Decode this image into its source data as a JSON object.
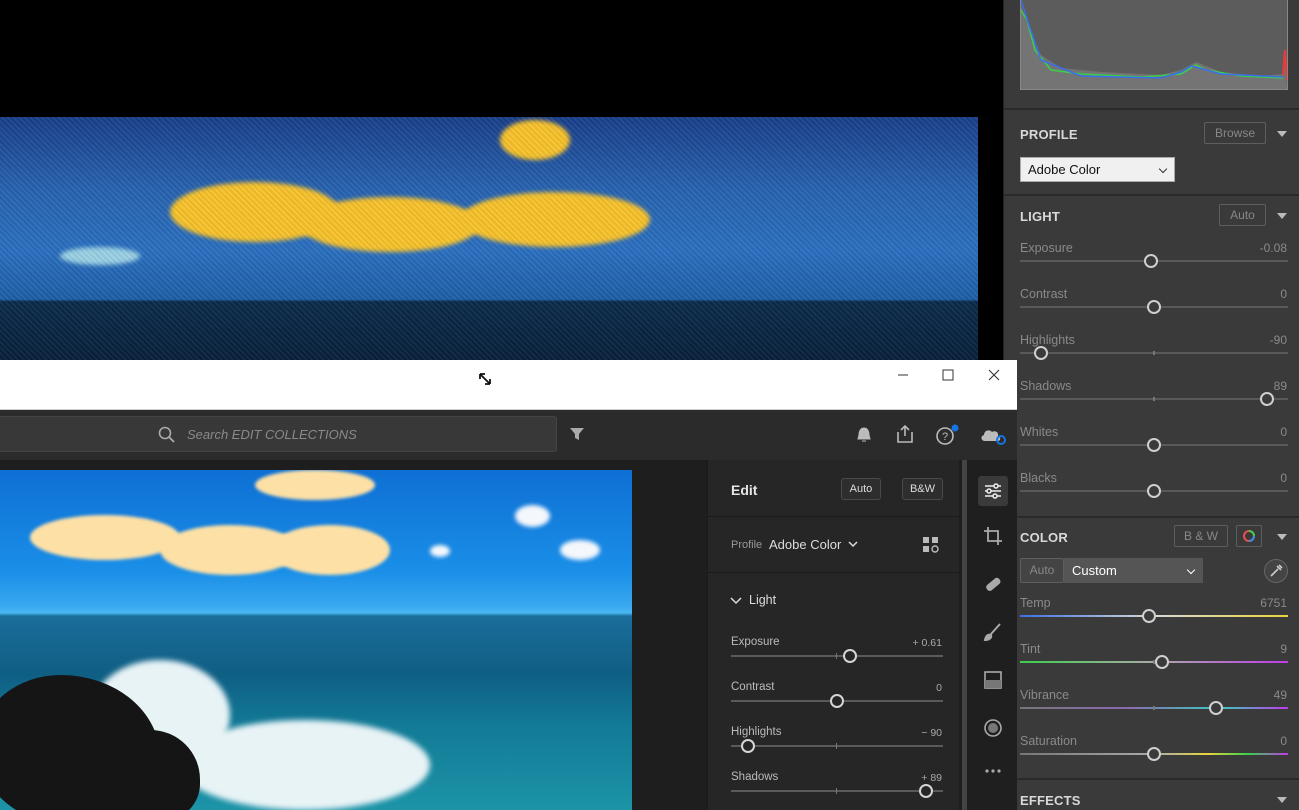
{
  "classic": {
    "profile": {
      "title": "PROFILE",
      "browse": "Browse",
      "select": "Adobe Color"
    },
    "light": {
      "title": "LIGHT",
      "auto": "Auto",
      "sliders": [
        {
          "label": "Exposure",
          "value": "-0.08",
          "pos": 0.49
        },
        {
          "label": "Contrast",
          "value": "0",
          "pos": 0.5
        },
        {
          "label": "Highlights",
          "value": "-90",
          "pos": 0.08
        },
        {
          "label": "Shadows",
          "value": "89",
          "pos": 0.92
        },
        {
          "label": "Whites",
          "value": "0",
          "pos": 0.5
        },
        {
          "label": "Blacks",
          "value": "0",
          "pos": 0.5
        }
      ]
    },
    "color": {
      "title": "COLOR",
      "bw": "B & W",
      "auto": "Auto",
      "select": "Custom",
      "sliders": [
        {
          "label": "Temp",
          "value": "6751",
          "pos": 0.48
        },
        {
          "label": "Tint",
          "value": "9",
          "pos": 0.53
        },
        {
          "label": "Vibrance",
          "value": "49",
          "pos": 0.73
        },
        {
          "label": "Saturation",
          "value": "0",
          "pos": 0.5
        }
      ]
    },
    "effects": {
      "title": "EFFECTS"
    }
  },
  "window": {
    "search_placeholder": "Search EDIT COLLECTIONS",
    "edit": {
      "title": "Edit",
      "auto": "Auto",
      "bw": "B&W",
      "profile_label": "Profile",
      "profile_value": "Adobe Color",
      "light_title": "Light",
      "sliders": [
        {
          "label": "Exposure",
          "value": "+ 0.61",
          "pos": 0.56
        },
        {
          "label": "Contrast",
          "value": "0",
          "pos": 0.5
        },
        {
          "label": "Highlights",
          "value": "− 90",
          "pos": 0.08
        },
        {
          "label": "Shadows",
          "value": "+ 89",
          "pos": 0.92
        }
      ]
    }
  },
  "icons": [
    "search-icon",
    "filter-icon",
    "bell-icon",
    "share-icon",
    "help-icon",
    "cloud-sync-icon",
    "sliders-icon",
    "crop-icon",
    "healing-icon",
    "brush-icon",
    "gradient-icon",
    "radial-icon",
    "more-icon",
    "eyedropper-icon",
    "color-wheel-icon"
  ],
  "colors": {
    "accent": "#1473e6"
  }
}
